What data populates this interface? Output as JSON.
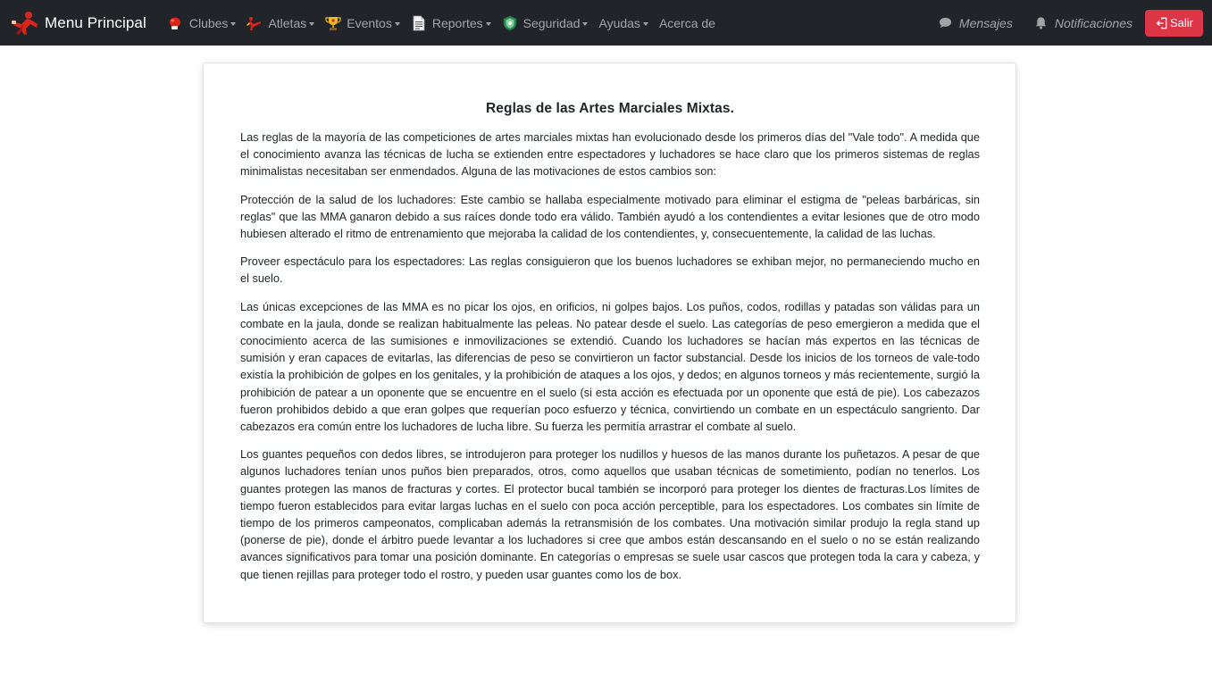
{
  "navbar": {
    "brand": {
      "label": "Menu Principal",
      "logo_icon": "fighter-logo-icon"
    },
    "items": [
      {
        "label": "Clubes",
        "icon": "boxing-glove-icon",
        "dropdown": true
      },
      {
        "label": "Atletas",
        "icon": "kick-icon",
        "dropdown": true
      },
      {
        "label": "Eventos",
        "icon": "trophy-icon",
        "dropdown": true
      },
      {
        "label": "Reportes",
        "icon": "document-icon",
        "dropdown": true
      },
      {
        "label": "Seguridad",
        "icon": "shield-icon",
        "dropdown": true
      },
      {
        "label": "Ayudas",
        "dropdown": true
      },
      {
        "label": "Acerca de",
        "dropdown": false
      }
    ],
    "right": {
      "messages": {
        "label": "Mensajes",
        "icon": "chat-bubble-icon"
      },
      "notifications": {
        "label": "Notificaciones",
        "icon": "bell-icon"
      },
      "logout": {
        "label": "Salir",
        "icon": "logout-icon"
      }
    },
    "colors": {
      "navbar_bg": "#212529",
      "logout_bg": "#dc3545"
    }
  },
  "content": {
    "title": "Reglas de las Artes Marciales Mixtas.",
    "paragraphs": [
      "Las reglas de la mayoría de las competiciones de artes marciales mixtas han evolucionado desde los primeros días del \"Vale todo\". A medida que el conocimiento avanza las técnicas de lucha se extienden entre espectadores y luchadores se hace claro que los primeros sistemas de reglas minimalistas necesitaban ser enmendados. Alguna de las motivaciones de estos cambios son:",
      "Protección de la salud de los luchadores: Este cambio se hallaba especialmente motivado para eliminar el estigma de \"peleas barbáricas, sin reglas\" que las MMA ganaron debido a sus raíces donde todo era válido. También ayudó a los contendientes a evitar lesiones que de otro modo hubiesen alterado el ritmo de entrenamiento que mejoraba la calidad de los contendientes, y, consecuentemente, la calidad de las luchas.",
      "Proveer espectáculo para los espectadores: Las reglas consiguieron que los buenos luchadores se exhiban mejor, no permaneciendo mucho en el suelo.",
      "Las únicas excepciones de las MMA es no picar los ojos, en orificios, ni golpes bajos. Los puños, codos, rodillas y patadas son válidas para un combate en la jaula, donde se realizan habitualmente las peleas. No patear desde el suelo. Las categorías de peso emergieron a medida que el conocimiento acerca de las sumisiones e inmovilizaciones se extendió. Cuando los luchadores se hacían más expertos en las técnicas de sumisión y eran capaces de evitarlas, las diferencias de peso se convirtieron un factor substancial. Desde los inicios de los torneos de vale-todo existía la prohibición de golpes en los genitales, y la prohibición de ataques a los ojos, y dedos; en algunos torneos y más recientemente, surgió la prohibición de patear a un oponente que se encuentre en el suelo (si esta acción es efectuada por un oponente que está de pie). Los cabezazos fueron prohibidos debido a que eran golpes que requerían poco esfuerzo y técnica, convirtiendo un combate en un espectáculo sangriento. Dar cabezazos era común entre los luchadores de lucha libre. Su fuerza les permitía arrastrar el combate al suelo.",
      "Los guantes pequeños con dedos libres, se introdujeron para proteger los nudillos y huesos de las manos durante los puñetazos. A pesar de que algunos luchadores tenían unos puños bien preparados, otros, como aquellos que usaban técnicas de sometimiento, podían no tenerlos. Los guantes protegen las manos de fracturas y cortes. El protector bucal también se incorporó para proteger los dientes de fracturas.Los límites de tiempo fueron establecidos para evitar largas luchas en el suelo con poca acción perceptible, para los espectadores. Los combates sin límite de tiempo de los primeros campeonatos, complicaban además la retransmisión de los combates. Una motivación similar produjo la regla stand up (ponerse de pie), donde el árbitro puede levantar a los luchadores si cree que ambos están descansando en el suelo o no se están realizando avances significativos para tomar una posición dominante. En categorías o empresas se suele usar cascos que protegen toda la cara y cabeza, y que tienen rejillas para proteger todo el rostro, y pueden usar guantes como los de box."
    ]
  }
}
